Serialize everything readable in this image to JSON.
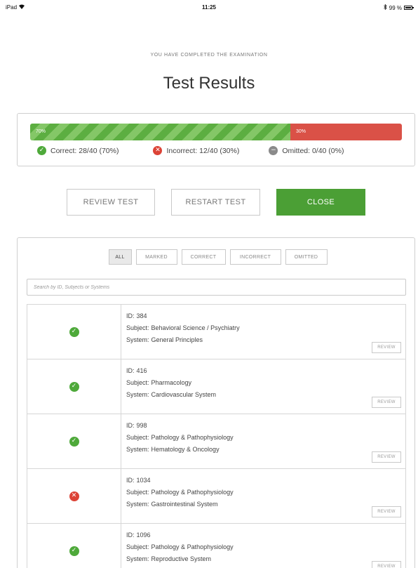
{
  "status_bar": {
    "device": "iPad",
    "time": "11:25",
    "battery": "99 %"
  },
  "header": {
    "subtitle": "YOU HAVE COMPLETED THE EXAMINATION",
    "title": "Test Results"
  },
  "summary": {
    "correct_bar_label": "70%",
    "incorrect_bar_label": "30%",
    "correct_fraction": 0.7,
    "incorrect_fraction": 0.3,
    "correct_text": "Correct: 28/40 (70%)",
    "incorrect_text": "Incorrect: 12/40 (30%)",
    "omitted_text": "Omitted: 0/40 (0%)"
  },
  "actions": {
    "review_label": "REVIEW TEST",
    "restart_label": "RESTART TEST",
    "close_label": "CLOSE"
  },
  "filters": {
    "all": "ALL",
    "marked": "MARKED",
    "correct": "CORRECT",
    "incorrect": "INCORRECT",
    "omitted": "OMITTED"
  },
  "search": {
    "placeholder": "Search by ID, Subjects or Systems"
  },
  "results": [
    {
      "status": "correct",
      "id_label": "ID:",
      "id": "384",
      "subject_label": "Subject:",
      "subject": "Behavioral Science / Psychiatry",
      "system_label": "System:",
      "system": "General Principles",
      "review_label": "REVIEW"
    },
    {
      "status": "correct",
      "id_label": "ID:",
      "id": "416",
      "subject_label": "Subject:",
      "subject": "Pharmacology",
      "system_label": "System:",
      "system": "Cardiovascular System",
      "review_label": "REVIEW"
    },
    {
      "status": "correct",
      "id_label": "ID:",
      "id": "998",
      "subject_label": "Subject:",
      "subject": "Pathology & Pathophysiology",
      "system_label": "System:",
      "system": "Hematology & Oncology",
      "review_label": "REVIEW"
    },
    {
      "status": "incorrect",
      "id_label": "ID:",
      "id": "1034",
      "subject_label": "Subject:",
      "subject": "Pathology & Pathophysiology",
      "system_label": "System:",
      "system": "Gastrointestinal System",
      "review_label": "REVIEW"
    },
    {
      "status": "correct",
      "id_label": "ID:",
      "id": "1096",
      "subject_label": "Subject:",
      "subject": "Pathology & Pathophysiology",
      "system_label": "System:",
      "system": "Reproductive System",
      "review_label": "REVIEW"
    }
  ],
  "colors": {
    "correct": "#4ea93a",
    "incorrect": "#dc4336",
    "omitted": "#8a8a8a",
    "close_button": "#4b9f35"
  },
  "icons": {
    "correct": "check-circle-icon",
    "incorrect": "x-circle-icon",
    "omitted": "minus-circle-icon",
    "wifi": "wifi-icon",
    "bluetooth": "bluetooth-icon",
    "battery": "battery-icon"
  }
}
